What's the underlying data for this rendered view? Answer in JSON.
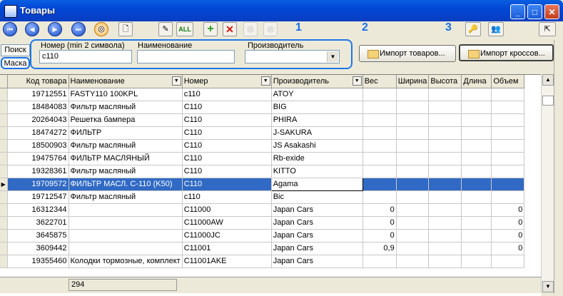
{
  "window": {
    "title": "Товары"
  },
  "callouts": [
    "1",
    "2",
    "3"
  ],
  "tabs": [
    {
      "label": "Поиск"
    },
    {
      "label": "Маска"
    }
  ],
  "search": {
    "number_label": "Номер (min 2 символа)",
    "number_value": "с110",
    "name_label": "Наименование",
    "name_value": "",
    "maker_label": "Производитель",
    "maker_value": ""
  },
  "buttons": {
    "import_goods": "Импорт товаров...",
    "import_cross": "Импорт кроссов..."
  },
  "toolbar": {
    "all_label": "ALL"
  },
  "grid": {
    "columns": [
      "Код товара",
      "Наименование",
      "Номер",
      "Производитель",
      "Вес",
      "Ширина",
      "Высота",
      "Длина",
      "Объем"
    ],
    "rows": [
      {
        "code": "19712551",
        "name": "FASTY110 100KPL",
        "number": "c110",
        "maker": "ATOY",
        "weight": "",
        "volume": ""
      },
      {
        "code": "18484083",
        "name": "Фильтр масляный",
        "number": "C110",
        "maker": "BIG",
        "weight": "",
        "volume": ""
      },
      {
        "code": "20264043",
        "name": "Решетка бампера",
        "number": "C110",
        "maker": "PHIRA",
        "weight": "",
        "volume": ""
      },
      {
        "code": "18474272",
        "name": "ФИЛЬТР",
        "number": "C110",
        "maker": "J-SAKURA",
        "weight": "",
        "volume": ""
      },
      {
        "code": "18500903",
        "name": "Фильтр масляный",
        "number": "C110",
        "maker": "JS Asakashi",
        "weight": "",
        "volume": ""
      },
      {
        "code": "19475764",
        "name": "ФИЛЬТР МАСЛЯНЫЙ",
        "number": "C110",
        "maker": "Rb-exide",
        "weight": "",
        "volume": ""
      },
      {
        "code": "19328361",
        "name": "Фильтр масляный",
        "number": "C110",
        "maker": "KITTO",
        "weight": "",
        "volume": ""
      },
      {
        "code": "19709572",
        "name": "ФИЛЬТР МАСЛ. С-110 (K50)",
        "number": "C110",
        "maker": "Agama",
        "weight": "",
        "volume": ""
      },
      {
        "code": "19712547",
        "name": "Фильтр масляный",
        "number": "c110",
        "maker": "Bic",
        "weight": "",
        "volume": ""
      },
      {
        "code": "16312344",
        "name": "",
        "number": "C11000",
        "maker": "Japan Cars",
        "weight": "0",
        "volume": "0"
      },
      {
        "code": "3622701",
        "name": "",
        "number": "C11000AW",
        "maker": "Japan Cars",
        "weight": "0",
        "volume": "0"
      },
      {
        "code": "3645875",
        "name": "",
        "number": "C11000JC",
        "maker": "Japan Cars",
        "weight": "0",
        "volume": "0"
      },
      {
        "code": "3609442",
        "name": "",
        "number": "C11001",
        "maker": "Japan Cars",
        "weight": "0,9",
        "volume": "0"
      },
      {
        "code": "19355460",
        "name": "Колодки тормозные, комплект",
        "number": "C11001AKE",
        "maker": "Japan Cars",
        "weight": "",
        "volume": ""
      }
    ],
    "selected_index": 7,
    "count": "294"
  }
}
